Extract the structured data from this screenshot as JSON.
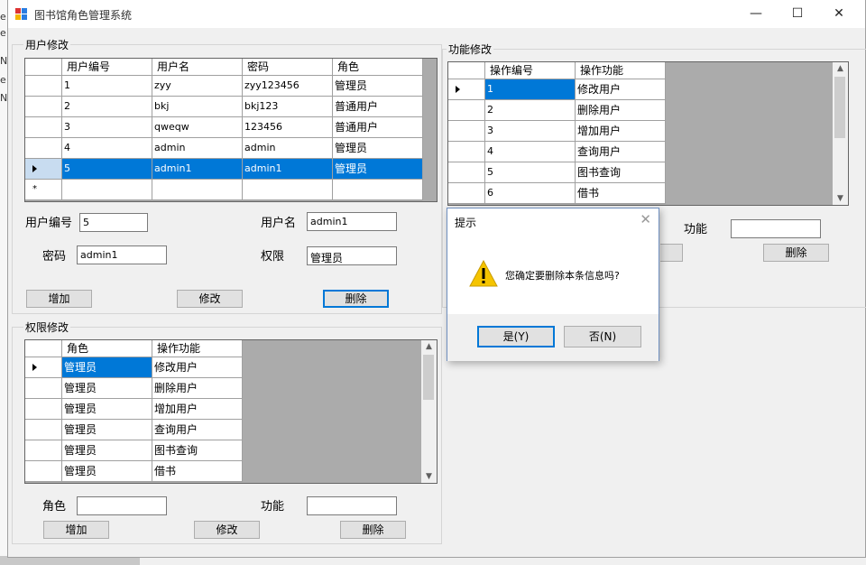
{
  "window": {
    "title": "图书馆角色管理系统",
    "minimize": "—",
    "maximize": "☐",
    "close": "✕"
  },
  "background": {
    "letters": [
      "e",
      "e",
      "Na",
      "e",
      "Na"
    ]
  },
  "user_group": {
    "title": "用户修改",
    "columns": [
      "用户编号",
      "用户名",
      "密码",
      "角色"
    ],
    "rows": [
      [
        "1",
        "zyy",
        "zyy123456",
        "管理员"
      ],
      [
        "2",
        "bkj",
        "bkj123",
        "普通用户"
      ],
      [
        "3",
        "qweqw",
        "123456",
        "普通用户"
      ],
      [
        "4",
        "admin",
        "admin",
        "管理员"
      ],
      [
        "5",
        "admin1",
        "admin1",
        "管理员"
      ]
    ],
    "new_row_marker": "*",
    "labels": {
      "id": "用户编号",
      "name": "用户名",
      "password": "密码",
      "role": "权限"
    },
    "values": {
      "id": "5",
      "name": "admin1",
      "password": "admin1",
      "role": "管理员"
    },
    "buttons": {
      "add": "增加",
      "edit": "修改",
      "delete": "删除"
    }
  },
  "function_group": {
    "title": "功能修改",
    "columns": [
      "操作编号",
      "操作功能"
    ],
    "rows": [
      [
        "1",
        "修改用户"
      ],
      [
        "2",
        "删除用户"
      ],
      [
        "3",
        "增加用户"
      ],
      [
        "4",
        "查询用户"
      ],
      [
        "5",
        "图书查询"
      ],
      [
        "6",
        "借书"
      ]
    ],
    "labels": {
      "function": "功能"
    },
    "values": {
      "function": ""
    },
    "buttons": {
      "delete": "删除"
    }
  },
  "permission_group": {
    "title": "权限修改",
    "columns": [
      "角色",
      "操作功能"
    ],
    "rows": [
      [
        "管理员",
        "修改用户"
      ],
      [
        "管理员",
        "删除用户"
      ],
      [
        "管理员",
        "增加用户"
      ],
      [
        "管理员",
        "查询用户"
      ],
      [
        "管理员",
        "图书查询"
      ],
      [
        "管理员",
        "借书"
      ]
    ],
    "labels": {
      "role": "角色",
      "function": "功能"
    },
    "values": {
      "role": "",
      "function": ""
    },
    "buttons": {
      "add": "增加",
      "edit": "修改",
      "delete": "删除"
    }
  },
  "dialog": {
    "title": "提示",
    "close": "✕",
    "message": "您确定要删除本条信息吗?",
    "yes": "是(Y)",
    "no": "否(N)",
    "icon": "warning-icon"
  },
  "colors": {
    "selection": "#0078d7",
    "grid_bg": "#ababab",
    "window_bg": "#f0f0f0",
    "warning": "#f5c400"
  }
}
